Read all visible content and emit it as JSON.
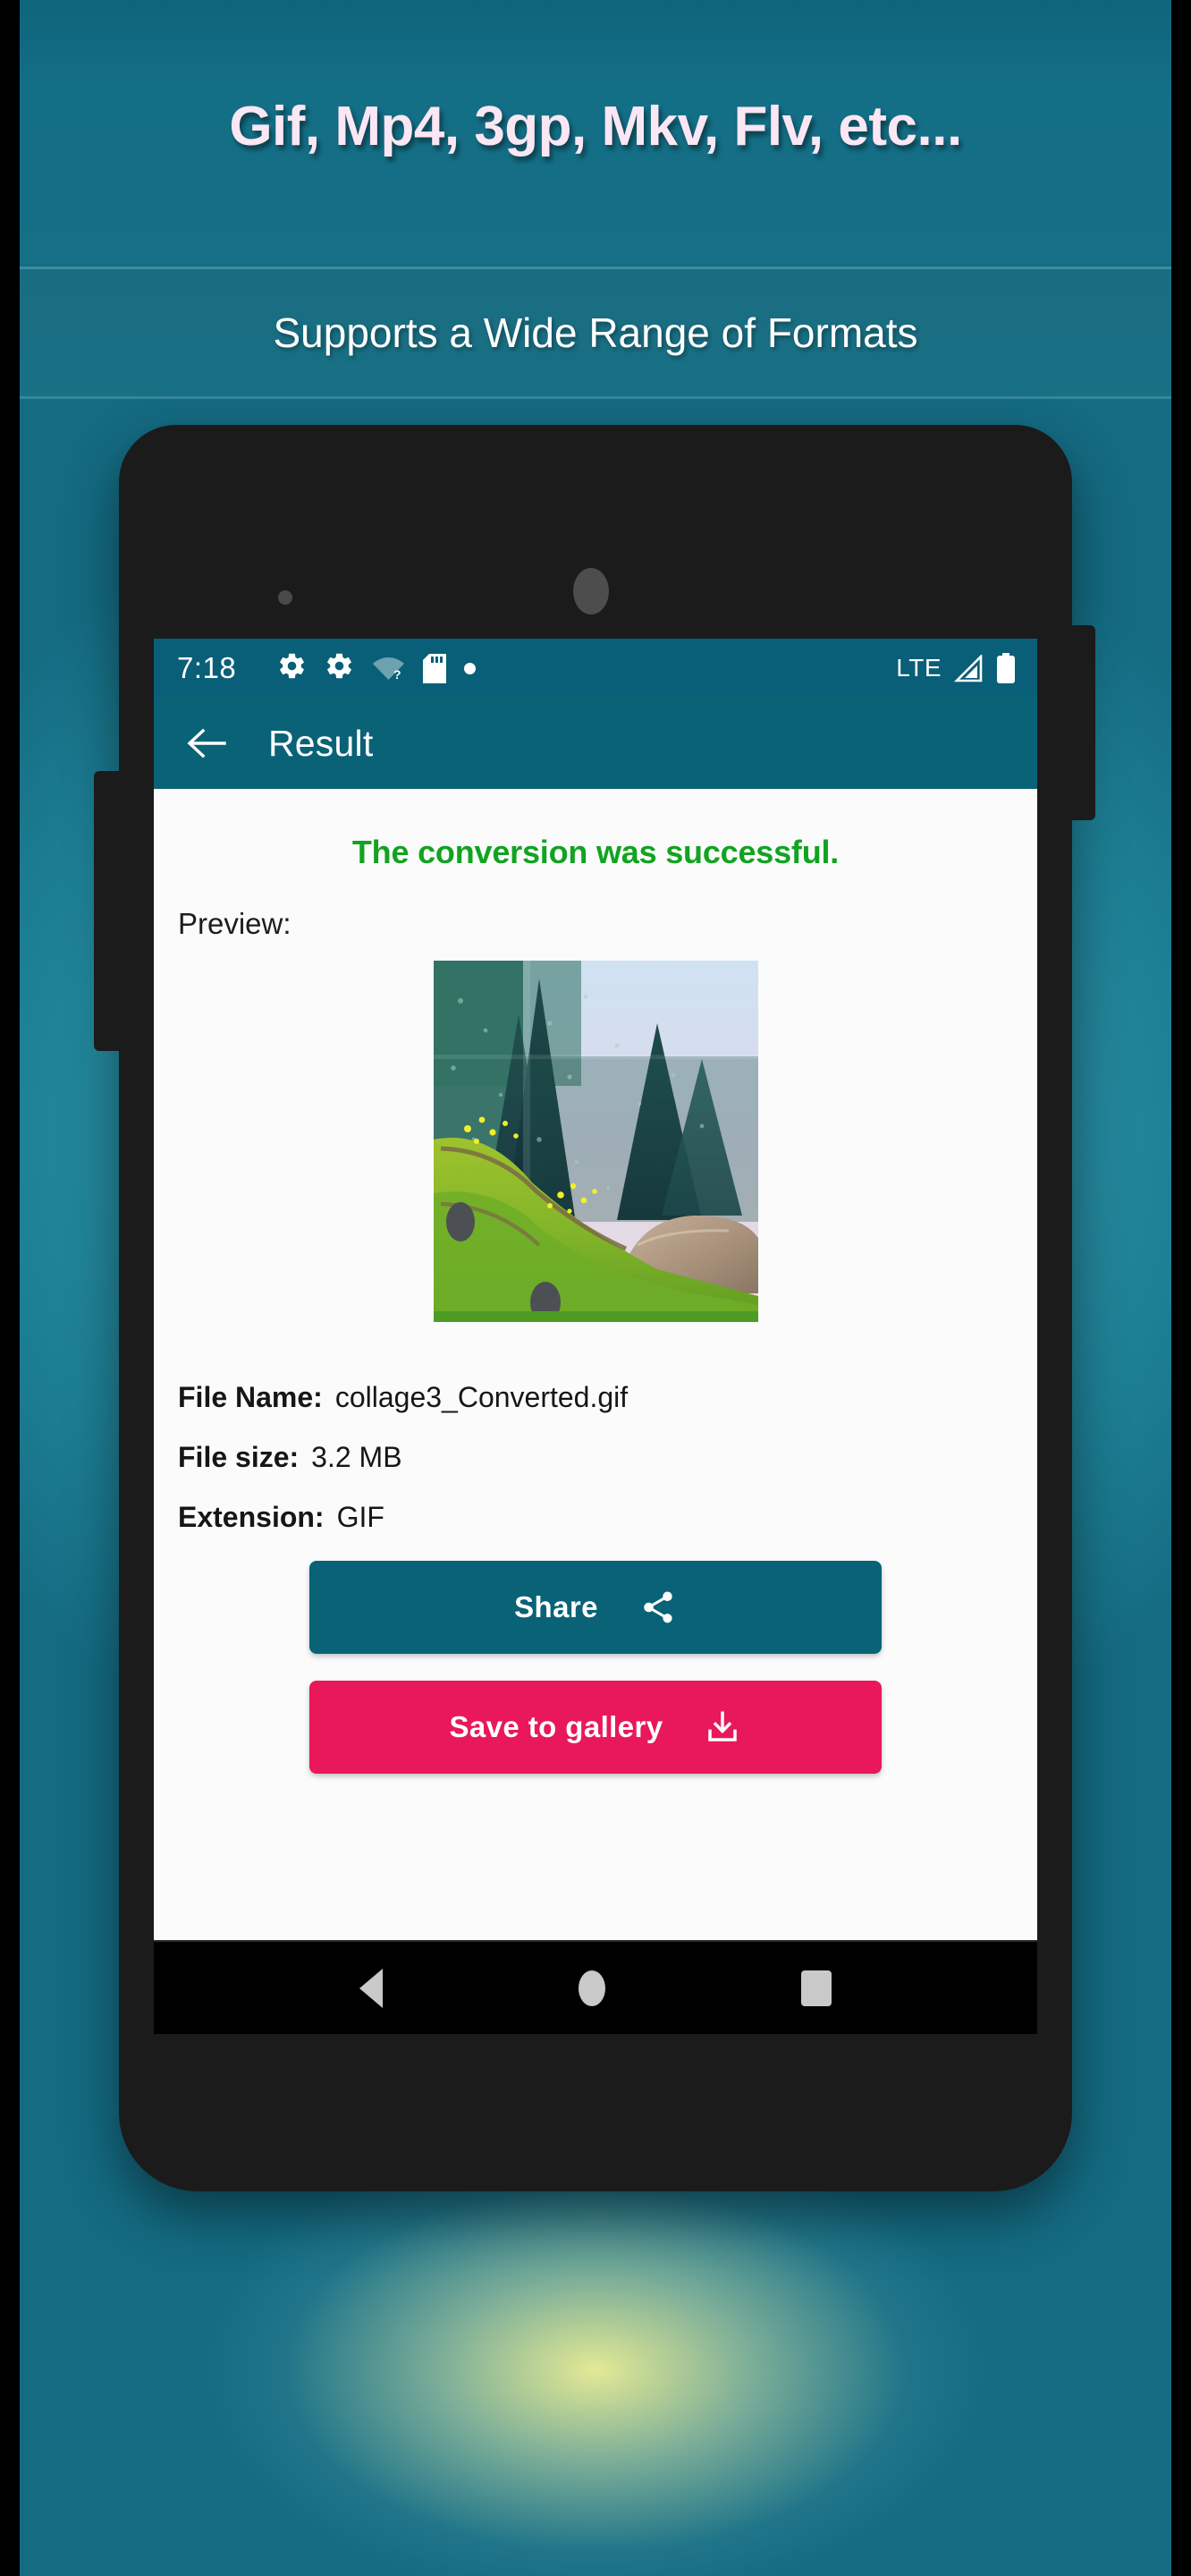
{
  "promo": {
    "headline": "Gif, Mp4, 3gp, Mkv, Flv, etc...",
    "subtitle": "Supports a Wide Range of Formats",
    "headline_color": "#FBE6F4",
    "subtitle_color": "#FFFFFF",
    "background_color": "#2E95A8"
  },
  "phone": {
    "status_bar": {
      "time": "7:18",
      "icons_left": [
        "gear-icon",
        "gear-icon",
        "wifi-question-icon",
        "sd-card-icon",
        "dot-icon"
      ],
      "network_label": "LTE",
      "icons_right": [
        "signal-icon",
        "battery-icon"
      ],
      "background_color": "#085F77"
    },
    "app_bar": {
      "back_icon": "arrow-left-icon",
      "title": "Result",
      "background_color": "#0A6277"
    },
    "content": {
      "success_message": "The conversion was successful.",
      "success_color": "#12A321",
      "preview_label": "Preview:",
      "preview_image_alt": "Converted GIF preview - grassy hill with pine trees and rock",
      "file_info": [
        {
          "key": "File Name:",
          "value": "collage3_Converted.gif"
        },
        {
          "key": "File size:",
          "value": "3.2 MB"
        },
        {
          "key": "Extension:",
          "value": "GIF"
        }
      ],
      "buttons": [
        {
          "label": "Share",
          "icon": "share-icon",
          "color": "#0A6277"
        },
        {
          "label": "Save to gallery",
          "icon": "download-icon",
          "color": "#E8185B"
        }
      ]
    },
    "nav_bar": {
      "items": [
        "back-triangle-icon",
        "home-circle-icon",
        "recents-square-icon"
      ],
      "background_color": "#000000"
    }
  }
}
